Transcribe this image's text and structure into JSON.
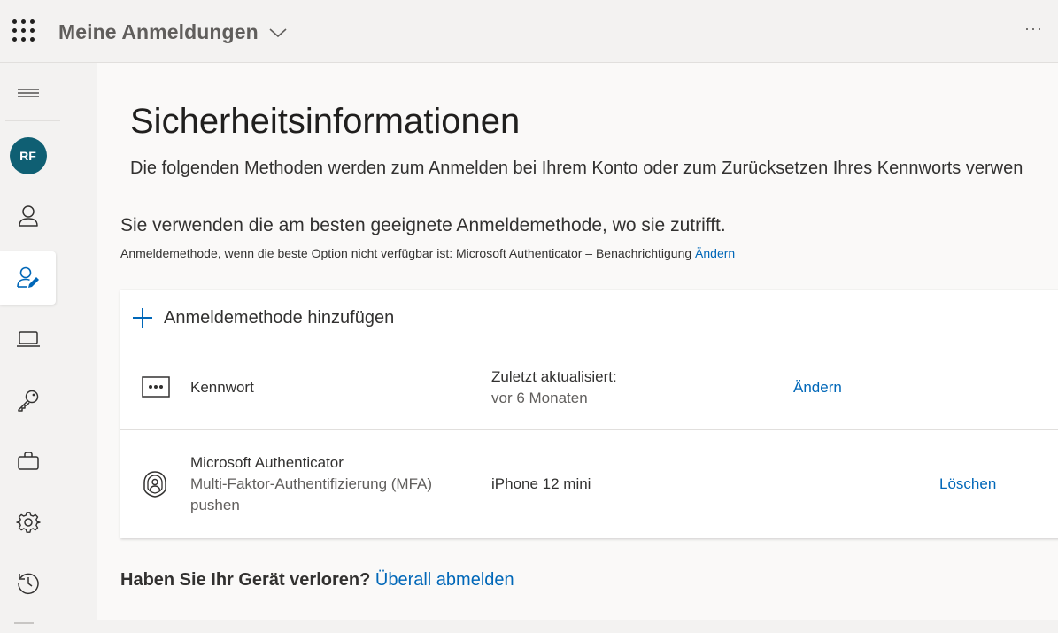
{
  "header": {
    "app_title": "Meine Anmeldungen",
    "more_label": "···"
  },
  "sidebar": {
    "avatar_initials": "RF",
    "items": [
      {
        "name": "menu",
        "icon": "hamburger-icon"
      },
      {
        "name": "profile",
        "icon": "avatar"
      },
      {
        "name": "overview",
        "icon": "person-icon"
      },
      {
        "name": "security-info",
        "icon": "person-edit-icon",
        "active": true
      },
      {
        "name": "devices",
        "icon": "laptop-icon"
      },
      {
        "name": "password",
        "icon": "key-icon"
      },
      {
        "name": "organizations",
        "icon": "briefcase-icon"
      },
      {
        "name": "settings",
        "icon": "gear-icon"
      },
      {
        "name": "recent-activity",
        "icon": "history-icon"
      }
    ]
  },
  "main": {
    "title": "Sicherheitsinformationen",
    "description": "Die folgenden Methoden werden zum Anmelden bei Ihrem Konto oder zum Zurücksetzen Ihres Kennworts verwen",
    "subheading": "Sie verwenden die am besten geeignete Anmeldemethode, wo sie zutrifft.",
    "default_method_text": "Anmeldemethode, wenn die beste Option nicht verfügbar ist: Microsoft Authenticator – Benachrichtigung",
    "default_method_link": "Ändern",
    "add_method_label": "Anmeldemethode hinzufügen",
    "methods": [
      {
        "icon": "password-dots-icon",
        "name": "Kennwort",
        "detail_label": "Zuletzt aktualisiert:",
        "detail_value": "vor 6 Monaten",
        "action": "Ändern"
      },
      {
        "icon": "authenticator-icon",
        "name": "Microsoft Authenticator",
        "subtitle_line1": "Multi-Faktor-Authentifizierung (MFA)",
        "subtitle_line2": "pushen",
        "device": "iPhone 12 mini",
        "action": "Löschen"
      }
    ],
    "lost_device_question": "Haben Sie Ihr Gerät verloren?",
    "lost_device_link": "Überall abmelden"
  },
  "colors": {
    "accent": "#0067b8",
    "avatar_bg": "#0f5f73",
    "background": "#f3f2f1",
    "card": "#ffffff"
  }
}
